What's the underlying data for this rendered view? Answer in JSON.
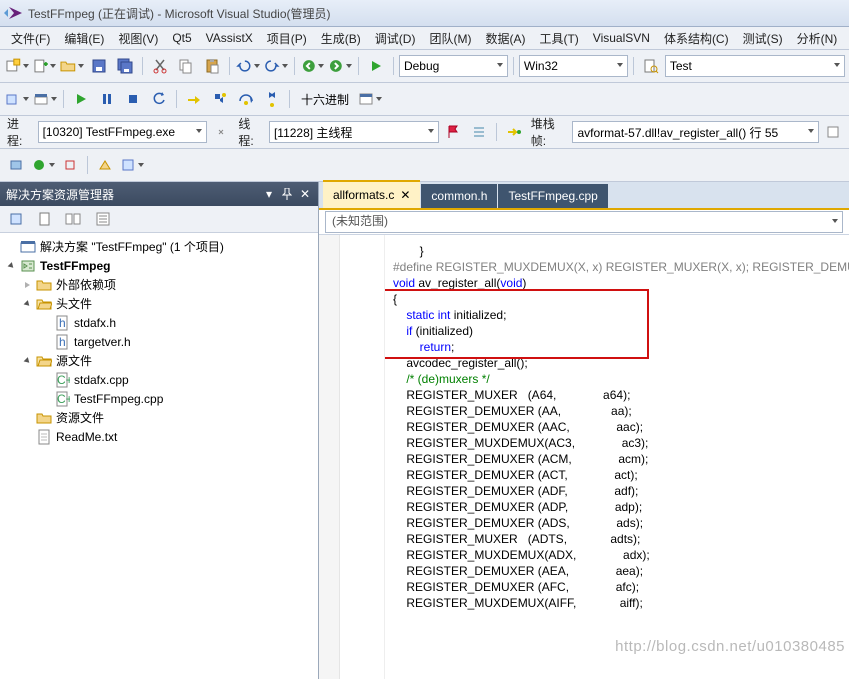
{
  "window": {
    "title": "TestFFmpeg (正在调试) - Microsoft Visual Studio(管理员)"
  },
  "menu": {
    "items": [
      "文件(F)",
      "编辑(E)",
      "视图(V)",
      "Qt5",
      "VAssistX",
      "项目(P)",
      "生成(B)",
      "调试(D)",
      "团队(M)",
      "数据(A)",
      "工具(T)",
      "VisualSVN",
      "体系结构(C)",
      "测试(S)",
      "分析(N)"
    ]
  },
  "toolbar1": {
    "config": "Debug",
    "platform": "Win32",
    "search": "Test",
    "hex_label": "十六进制"
  },
  "process_bar": {
    "process_label": "进程:",
    "process_value": "[10320] TestFFmpeg.exe",
    "thread_label": "线程:",
    "thread_value": "[11228] 主线程",
    "stack_label": "堆栈帧:",
    "stack_value": "avformat-57.dll!av_register_all() 行 55"
  },
  "sln": {
    "title": "解决方案资源管理器",
    "solution": "解决方案 \"TestFFmpeg\" (1 个项目)",
    "project": "TestFFmpeg",
    "folders": {
      "ext_deps": "外部依赖项",
      "headers": "头文件",
      "sources": "源文件",
      "resources": "资源文件"
    },
    "header_files": [
      "stdafx.h",
      "targetver.h"
    ],
    "source_files": [
      "stdafx.cpp",
      "TestFFmpeg.cpp"
    ],
    "other_files": [
      "ReadMe.txt"
    ]
  },
  "tabs": {
    "items": [
      "allformats.c",
      "common.h",
      "TestFFmpeg.cpp"
    ],
    "active": 0
  },
  "scope": {
    "text": "(未知范围)"
  },
  "code_lines": [
    "        }",
    "",
    "#define REGISTER_MUXDEMUX(X, x) REGISTER_MUXER(X, x); REGISTER_DEMUXER(X",
    "",
    "void av_register_all(void)",
    "{",
    "    static int initialized;",
    "",
    "    if (initialized)",
    "        return;",
    "",
    "    avcodec_register_all();",
    "",
    "    /* (de)muxers */",
    "    REGISTER_MUXER   (A64,              a64);",
    "    REGISTER_DEMUXER (AA,               aa);",
    "    REGISTER_DEMUXER (AAC,              aac);",
    "    REGISTER_MUXDEMUX(AC3,              ac3);",
    "    REGISTER_DEMUXER (ACM,              acm);",
    "    REGISTER_DEMUXER (ACT,              act);",
    "    REGISTER_DEMUXER (ADF,              adf);",
    "    REGISTER_DEMUXER (ADP,              adp);",
    "    REGISTER_DEMUXER (ADS,              ads);",
    "    REGISTER_MUXER   (ADTS,             adts);",
    "    REGISTER_MUXDEMUX(ADX,              adx);",
    "    REGISTER_DEMUXER (AEA,              aea);",
    "    REGISTER_DEMUXER (AFC,              afc);",
    "    REGISTER_MUXDEMUX(AIFF,             aiff);"
  ],
  "watermark": "http://blog.csdn.net/u010380485"
}
